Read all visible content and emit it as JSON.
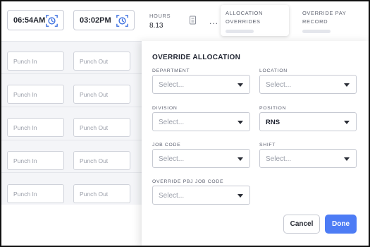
{
  "header": {
    "clock_in_time": "06:54AM",
    "clock_out_time": "03:02PM",
    "hours_label": "HOURS",
    "hours_value": "8.13",
    "more_label": "...",
    "tabs": [
      {
        "line1": "ALLOCATION",
        "line2": "OVERRIDES"
      },
      {
        "line1": "OVERRIDE PAY",
        "line2": "RECORD"
      }
    ]
  },
  "rows": [
    {
      "punch_in": "Punch In",
      "punch_out": "Punch Out"
    },
    {
      "punch_in": "Punch In",
      "punch_out": "Punch Out"
    },
    {
      "punch_in": "Punch In",
      "punch_out": "Punch Out"
    },
    {
      "punch_in": "Punch In",
      "punch_out": "Punch Out"
    },
    {
      "punch_in": "Punch In",
      "punch_out": "Punch Out"
    }
  ],
  "panel": {
    "title": "OVERRIDE ALLOCATION",
    "fields": {
      "department": {
        "label": "DEPARTMENT",
        "value": "Select..."
      },
      "location": {
        "label": "LOCATION",
        "value": "Select..."
      },
      "division": {
        "label": "DIVISION",
        "value": "Select..."
      },
      "position": {
        "label": "POSITION",
        "value": "RNS"
      },
      "job_code": {
        "label": "JOB CODE",
        "value": "Select..."
      },
      "shift": {
        "label": "SHIFT",
        "value": "Select..."
      },
      "pbj_job_code": {
        "label": "OVERRIDE PBJ JOB CODE",
        "value": "Select..."
      }
    },
    "cancel_label": "Cancel",
    "done_label": "Done"
  },
  "colors": {
    "primary": "#4d7cf5",
    "clock_icon": "#3b6fe0"
  }
}
